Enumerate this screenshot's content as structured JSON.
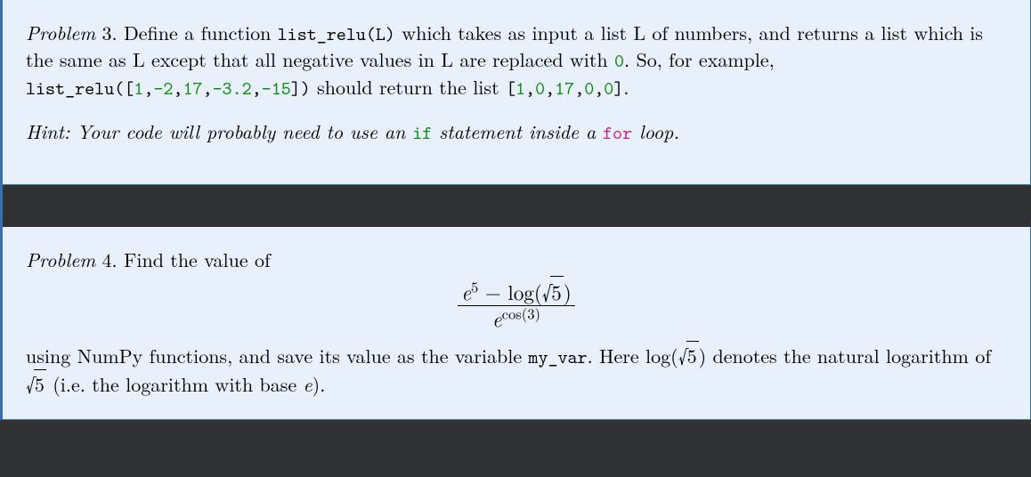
{
  "problem3": {
    "label": "Problem",
    "number": "3.",
    "sentence_a": "Define a function ",
    "funcname": "list_relu(L)",
    "sentence_b": " which takes as input a list L of numbers, and returns a list which is the same as L except that all negative values in L are replaced with ",
    "zero_literal": "0",
    "sentence_c": ". So, for example, ",
    "call_prefix": "list_relu([",
    "args": [
      "1",
      ",",
      "-2",
      ",",
      "17",
      ",",
      "-3.2",
      ",",
      "-15"
    ],
    "call_suffix": "])",
    "sentence_d": " should return the list ",
    "result_prefix": "[",
    "result_vals": [
      "1",
      ",",
      "0",
      ",",
      "17",
      ",",
      "0",
      ",",
      "0"
    ],
    "result_suffix": "]",
    "sentence_e": ".",
    "hint_prefix": "Hint: Your code will probably need to use an ",
    "hint_if": "if",
    "hint_mid": " statement inside a ",
    "hint_for": "for",
    "hint_suffix": " loop."
  },
  "problem4": {
    "label": "Problem",
    "number": "4.",
    "sentence_a": "Find the value of",
    "frac_top_lead": "e",
    "frac_top_sup": "5",
    "frac_top_minus": " − log(",
    "frac_top_sqrt": "5",
    "frac_top_close": ")",
    "frac_bot_e": "e",
    "frac_bot_sup": "cos(3)",
    "sentence_b_1": "using NumPy functions, and save its value as the variable ",
    "varname": "my_var",
    "sentence_b_2": ". Here log(",
    "sqrt_b": "5",
    "sentence_b_3": ") denotes the natural logarithm of ",
    "sqrt_c": "5",
    "sentence_b_4": " (i.e. the logarithm with base ",
    "e_letter": "e",
    "sentence_b_5": ")."
  }
}
